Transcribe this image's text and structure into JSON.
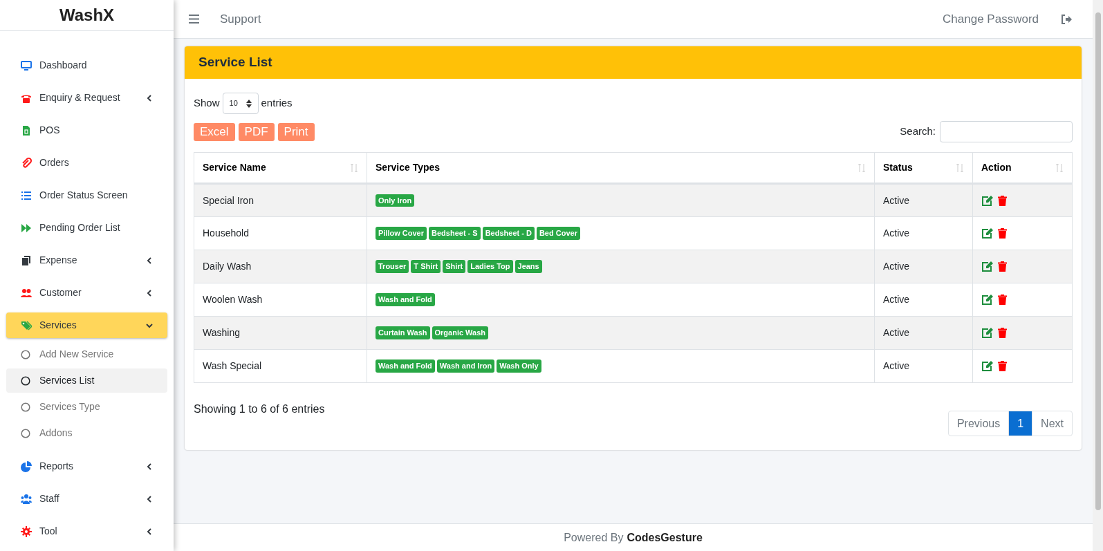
{
  "brand": "WashX",
  "sidebar": {
    "items": [
      {
        "label": "Dashboard",
        "color": "#1a73e8",
        "caret": false,
        "selected": false
      },
      {
        "label": "Enquiry & Request",
        "color": "#ff1a1a",
        "caret": true,
        "selected": false
      },
      {
        "label": "POS",
        "color": "#28a745",
        "caret": false,
        "selected": false
      },
      {
        "label": "Orders",
        "color": "#ff1a1a",
        "caret": false,
        "selected": false
      },
      {
        "label": "Order Status Screen",
        "color": "#1a73e8",
        "caret": false,
        "selected": false
      },
      {
        "label": "Pending Order List",
        "color": "#28a745",
        "caret": false,
        "selected": false
      },
      {
        "label": "Expense",
        "color": "#343a40",
        "caret": true,
        "selected": false
      },
      {
        "label": "Customer",
        "color": "#ff1a1a",
        "caret": true,
        "selected": false
      },
      {
        "label": "Services",
        "color": "#28a745",
        "caret": true,
        "selected": true,
        "expanded": true,
        "children": [
          {
            "label": "Add New Service",
            "selected": false
          },
          {
            "label": "Services List",
            "selected": true
          },
          {
            "label": "Services Type",
            "selected": false
          },
          {
            "label": "Addons",
            "selected": false
          }
        ]
      },
      {
        "label": "Reports",
        "color": "#1a73e8",
        "caret": true,
        "selected": false
      },
      {
        "label": "Staff",
        "color": "#1a73e8",
        "caret": true,
        "selected": false
      },
      {
        "label": "Tool",
        "color": "#ff1a1a",
        "caret": true,
        "selected": false
      }
    ]
  },
  "topbar": {
    "links": [
      "Support"
    ],
    "change_password": "Change Password"
  },
  "card": {
    "title": "Service List",
    "show": "Show",
    "entries_value": "10",
    "entries": "entries",
    "buttons": [
      "Excel",
      "PDF",
      "Print"
    ],
    "search_label": "Search:",
    "table": {
      "columns": [
        "Service Name",
        "Service Types",
        "Status",
        "Action"
      ],
      "rows": [
        {
          "name": "Special Iron",
          "types": [
            "Only Iron"
          ],
          "status": "Active"
        },
        {
          "name": "Household",
          "types": [
            "Pillow Cover",
            "Bedsheet - S",
            "Bedsheet - D",
            "Bed Cover"
          ],
          "status": "Active"
        },
        {
          "name": "Daily Wash",
          "types": [
            "Trouser",
            "T Shirt",
            "Shirt",
            "Ladies Top",
            "Jeans"
          ],
          "status": "Active"
        },
        {
          "name": "Woolen Wash",
          "types": [
            "Wash and Fold"
          ],
          "status": "Active"
        },
        {
          "name": "Washing",
          "types": [
            "Curtain Wash",
            "Organic Wash"
          ],
          "status": "Active"
        },
        {
          "name": "Wash Special",
          "types": [
            "Wash and Fold",
            "Wash and Iron",
            "Wash Only"
          ],
          "status": "Active"
        }
      ]
    },
    "info": "Showing 1 to 6 of 6 entries",
    "pagination": [
      {
        "label": "Previous",
        "selected": false
      },
      {
        "label": "1",
        "selected": true
      },
      {
        "label": "Next",
        "selected": false
      }
    ]
  },
  "footer": {
    "prefix": "Powered By",
    "brand": "CodesGesture"
  }
}
